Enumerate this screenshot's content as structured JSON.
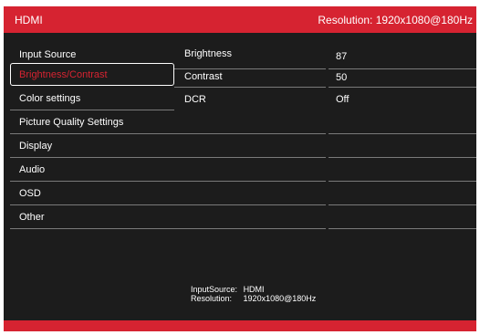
{
  "header": {
    "title": "HDMI",
    "resolution": "Resolution: 1920x1080@180Hz"
  },
  "menu": {
    "items": [
      {
        "label": "Input Source"
      },
      {
        "label": "Brightness/Contrast"
      },
      {
        "label": "Color settings"
      },
      {
        "label": "Picture Quality Settings"
      },
      {
        "label": "Display"
      },
      {
        "label": "Audio"
      },
      {
        "label": "OSD"
      },
      {
        "label": "Other"
      }
    ],
    "selected": "Brightness/Contrast"
  },
  "settings": [
    {
      "name": "Brightness",
      "value": "87"
    },
    {
      "name": "Contrast",
      "value": "50"
    },
    {
      "name": "DCR",
      "value": "Off"
    }
  ],
  "info": {
    "input_label": "InputSource:",
    "input_value": "HDMI",
    "resolution_label": "Resolution:",
    "resolution_value": "1920x1080@180Hz"
  },
  "colors": {
    "accent": "#d62331",
    "background": "#1c1c1c",
    "text": "#ffffff",
    "separator": "#7a7a7a"
  }
}
